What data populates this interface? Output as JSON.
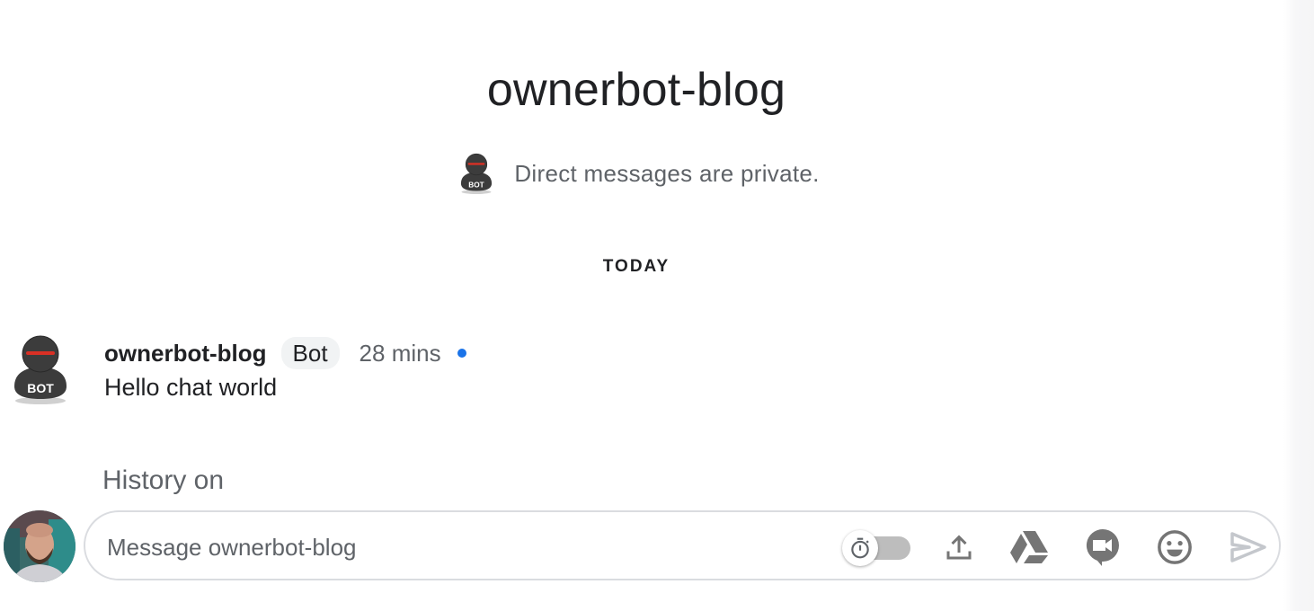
{
  "header": {
    "title": "ownerbot-blog",
    "privacy_notice": "Direct messages are private."
  },
  "date_divider": "TODAY",
  "messages": [
    {
      "sender": "ownerbot-blog",
      "badge": "Bot",
      "timestamp": "28 mins",
      "unread": true,
      "text": "Hello chat world",
      "avatar_icon": "bot-avatar-icon"
    }
  ],
  "history_status": "History on",
  "composer": {
    "placeholder": "Message ownerbot-blog",
    "value": "",
    "history_toggle_on": false,
    "icons": [
      "timer-icon",
      "upload-icon",
      "google-drive-icon",
      "video-meet-icon",
      "emoji-icon",
      "send-icon"
    ]
  },
  "colors": {
    "accent": "#1a73e8",
    "text_primary": "#202124",
    "text_secondary": "#5f6368",
    "icon": "#757575",
    "badge_bg": "#f1f3f4"
  }
}
